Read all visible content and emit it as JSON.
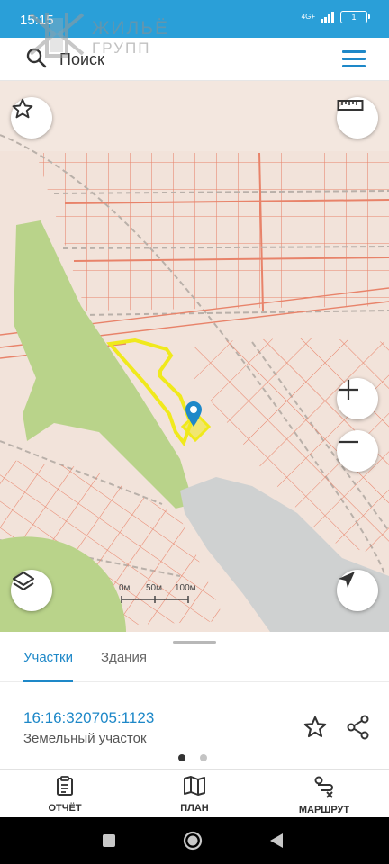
{
  "status_bar": {
    "time": "15:15",
    "network": "4G+",
    "battery": "1"
  },
  "watermark": {
    "line1": "ЖИЛЬЁ",
    "line2": "ГРУПП"
  },
  "search": {
    "placeholder": "Поиск",
    "icon": "search-icon",
    "menu_icon": "hamburger-menu-icon"
  },
  "map": {
    "favorites_icon": "star-icon",
    "ruler_icon": "ruler-icon",
    "zoom_in_icon": "plus-icon",
    "zoom_out_icon": "minus-icon",
    "layers_icon": "layers-icon",
    "locate_icon": "navigation-arrow-icon",
    "scale_labels": [
      "0м",
      "50м",
      "100м"
    ]
  },
  "panel": {
    "tabs": [
      {
        "label": "Участки",
        "active": true
      },
      {
        "label": "Здания",
        "active": false
      }
    ],
    "parcel": {
      "cadastral_number": "16:16:320705:1123",
      "type": "Земельный участок"
    },
    "page_dots": 2,
    "active_dot": 1
  },
  "bottom_nav": [
    {
      "label": "ОТЧЁТ",
      "icon": "clipboard-icon"
    },
    {
      "label": "ПЛАН",
      "icon": "map-icon"
    },
    {
      "label": "МАРШРУТ",
      "icon": "route-icon"
    }
  ],
  "colors": {
    "accent": "#1e88c8",
    "status_bar": "#2a9fd8",
    "parcel_lines": "#e8836a",
    "map_base": "#f2e3da",
    "green_area": "#b9d38a",
    "water": "#cfd1d1",
    "highlight": "#f0e91c"
  }
}
